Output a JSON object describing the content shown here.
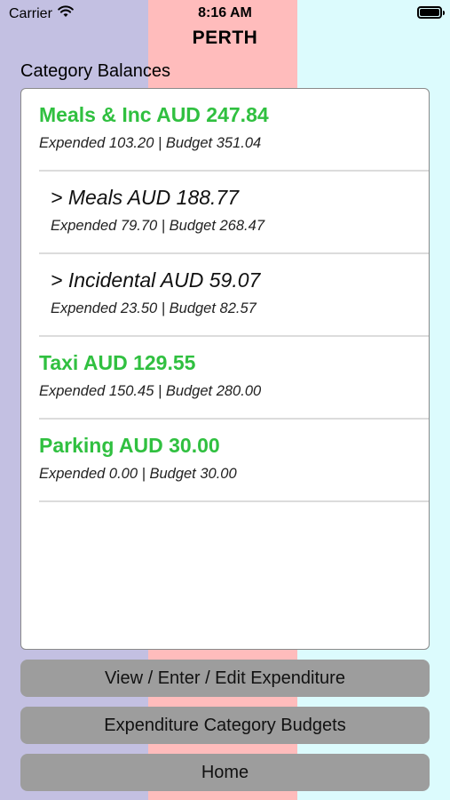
{
  "status_bar": {
    "carrier": "Carrier",
    "time": "8:16 AM",
    "battery_level": 1.0
  },
  "nav": {
    "title": "PERTH"
  },
  "section": {
    "label": "Category Balances"
  },
  "categories": [
    {
      "title": "Meals & Inc AUD 247.84",
      "detail": "Expended 103.20  |  Budget 351.04",
      "kind": "category",
      "color": "#30c040"
    },
    {
      "title": "> Meals AUD 188.77",
      "detail": "Expended 79.70  |  Budget 268.47",
      "kind": "subcategory"
    },
    {
      "title": "> Incidental AUD 59.07",
      "detail": "Expended 23.50  |  Budget 82.57",
      "kind": "subcategory"
    },
    {
      "title": "Taxi AUD 129.55",
      "detail": "Expended 150.45  |  Budget 280.00",
      "kind": "category",
      "color": "#30c040"
    },
    {
      "title": "Parking AUD 30.00",
      "detail": "Expended 0.00  |  Budget 30.00",
      "kind": "category",
      "color": "#30c040"
    }
  ],
  "buttons": {
    "view_enter_edit": "View / Enter / Edit Expenditure",
    "category_budgets": "Expenditure Category Budgets",
    "home": "Home"
  },
  "colors": {
    "left_band": "#c3c0e2",
    "middle_band": "#ffbcbc",
    "right_band": "#dcfbfd",
    "category_green": "#30c040",
    "button_gray": "#9d9d9d"
  },
  "icons": {
    "wifi": "wifi-icon",
    "battery": "battery-icon"
  }
}
